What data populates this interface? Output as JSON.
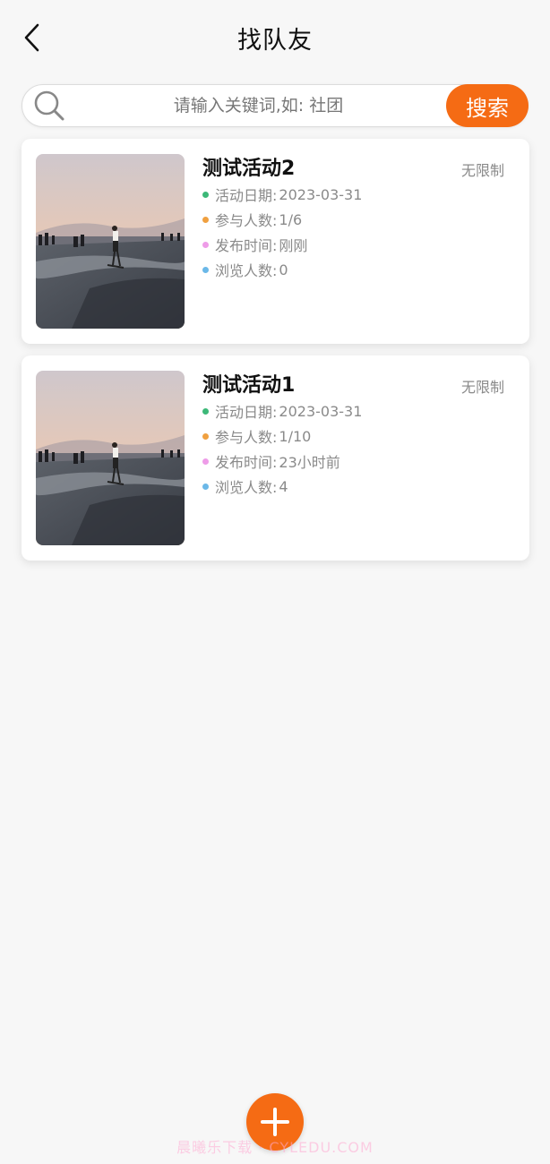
{
  "header": {
    "title": "找队友",
    "back_icon": "chevron-left-icon"
  },
  "search": {
    "placeholder": "请输入关键词,如: 社团",
    "value": "",
    "button_label": "搜索",
    "icon": "search-icon"
  },
  "cards": [
    {
      "title": "测试活动2",
      "limit": "无限制",
      "date_label": "活动日期:",
      "date_value": "2023-03-31",
      "participants_label": "参与人数:",
      "participants_value": "1/6",
      "published_label": "发布时间:",
      "published_value": "刚刚",
      "views_label": "浏览人数:",
      "views_value": "0"
    },
    {
      "title": "测试活动1",
      "limit": "无限制",
      "date_label": "活动日期:",
      "date_value": "2023-03-31",
      "participants_label": "参与人数:",
      "participants_value": "1/10",
      "published_label": "发布时间:",
      "published_value": "23小时前",
      "views_label": "浏览人数:",
      "views_value": "4"
    }
  ],
  "fab": {
    "icon": "plus-icon"
  },
  "watermark": "晨曦乐下载 · CYLEDU.COM",
  "colors": {
    "accent": "#f56b14",
    "dot_date": "#3cb878",
    "dot_participants": "#f0a040",
    "dot_published": "#ee9ce8",
    "dot_views": "#6bb8e8"
  }
}
